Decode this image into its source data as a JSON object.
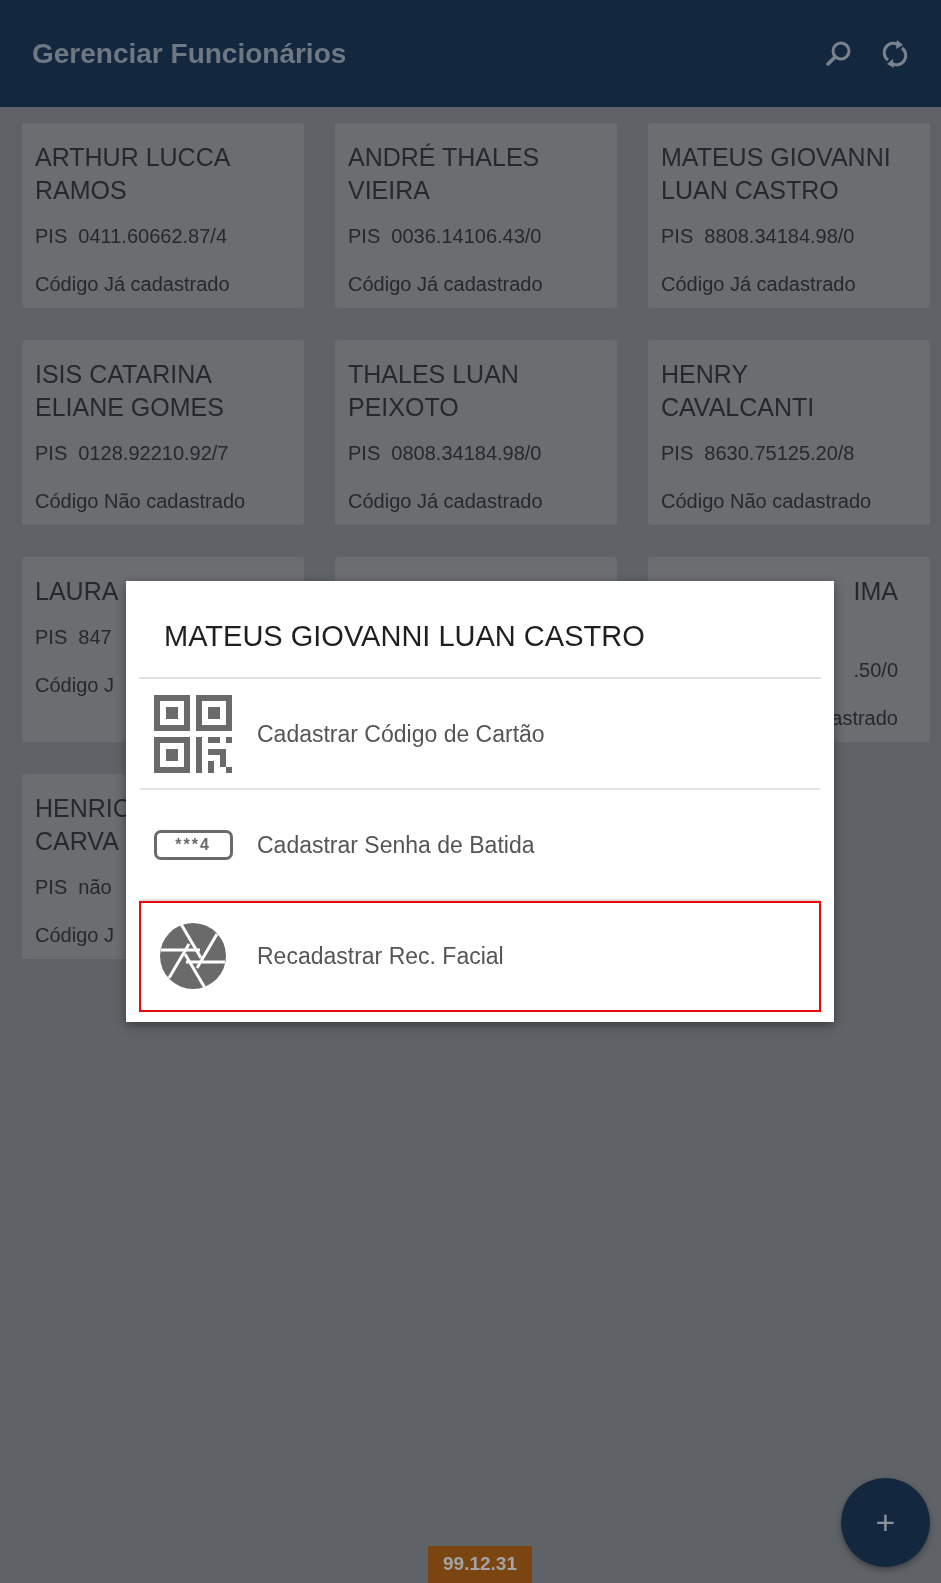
{
  "app_bar": {
    "title": "Gerenciar Funcionários"
  },
  "cards": [
    {
      "kind": "full",
      "name_lines": [
        "ARTHUR LUCCA",
        "RAMOS"
      ],
      "pis": "PIS  0411.60662.87/4",
      "code": "Código Já cadastrado"
    },
    {
      "kind": "full",
      "name_lines": [
        "ANDRÉ THALES",
        "VIEIRA"
      ],
      "pis": "PIS  0036.14106.43/0",
      "code": "Código Já cadastrado"
    },
    {
      "kind": "full",
      "name_lines": [
        "MATEUS GIOVANNI",
        "LUAN CASTRO"
      ],
      "pis": "PIS  8808.34184.98/0",
      "code": "Código Já cadastrado"
    },
    {
      "kind": "full",
      "name_lines": [
        "ISIS CATARINA",
        "ELIANE GOMES"
      ],
      "pis": "PIS  0128.92210.92/7",
      "code": "Código Não cadastrado"
    },
    {
      "kind": "full",
      "name_lines": [
        "THALES LUAN",
        "PEIXOTO"
      ],
      "pis": "PIS  0808.34184.98/0",
      "code": "Código Já cadastrado"
    },
    {
      "kind": "full",
      "name_lines": [
        "HENRY",
        "CAVALCANTI"
      ],
      "pis": "PIS  8630.75125.20/8",
      "code": "Código Não cadastrado"
    },
    {
      "kind": "cut_right",
      "name_lines": [
        "LAURA"
      ],
      "pis": "PIS  847",
      "code": "Código J"
    },
    {
      "kind": "hidden"
    },
    {
      "kind": "cut_left",
      "name_lines": [
        "IMA"
      ],
      "pis": ".50/0",
      "code": "astrado"
    },
    {
      "kind": "cut_right",
      "name_lines": [
        "HENRIC",
        "CARVA"
      ],
      "pis": "PIS  não",
      "code": "Código J"
    }
  ],
  "dialog": {
    "title": "MATEUS GIOVANNI LUAN CASTRO",
    "items": [
      {
        "kind": "qr",
        "label": "Cadastrar Código de Cartão",
        "highlighted": false
      },
      {
        "kind": "password",
        "icon_text": "***4",
        "label": "Cadastrar Senha de Batida",
        "highlighted": false
      },
      {
        "kind": "camera",
        "label": "Recadastrar Rec. Facial",
        "highlighted": true
      }
    ]
  },
  "version": "99.12.31",
  "fab": {
    "label": "+"
  }
}
